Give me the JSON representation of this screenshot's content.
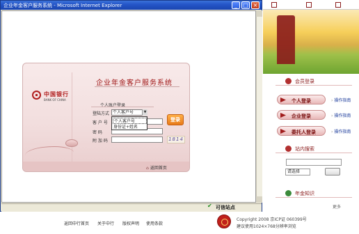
{
  "window": {
    "title": "企业年金客户服务系统 - Microsoft Internet Explorer",
    "status_text": "可信站点"
  },
  "login": {
    "system_title": "企业年金客户服务系统",
    "section_title": "个人账户登录",
    "bank_name_cn": "中国银行",
    "bank_name_en": "BANK OF CHINA",
    "login_mode_label": "登陆方式",
    "login_mode_value": "个人客户号",
    "login_mode_options": [
      "个人客户号",
      "身份证+姓名"
    ],
    "customer_label": "客 户 号",
    "password_label": "密    码",
    "code_label": "附 加 码",
    "captcha_text": "1814",
    "login_button": "登录",
    "return_home": "返回首页"
  },
  "sidebar": {
    "user_login_heading": "会员登录",
    "buttons": [
      {
        "label": "个人登录",
        "link": "操作指南"
      },
      {
        "label": "企业登录",
        "link": "操作指南"
      },
      {
        "label": "委托人登录",
        "link": "操作指南"
      }
    ],
    "search_heading": "站内搜索",
    "search_select": "请选择",
    "knowledge_heading": "年金知识",
    "more": "更多"
  },
  "footer": {
    "links": [
      "返回中行首页",
      "关于中行",
      "版权声明",
      "使用条款"
    ],
    "copyright": "Copyright 2008 京ICP证 060399号",
    "resolution_note": "建议使用1024×768分辨率浏览"
  },
  "colors": {
    "brand_red": "#a01818",
    "title_bar_blue": "#2556c8",
    "login_orange": "#e87a1a"
  }
}
